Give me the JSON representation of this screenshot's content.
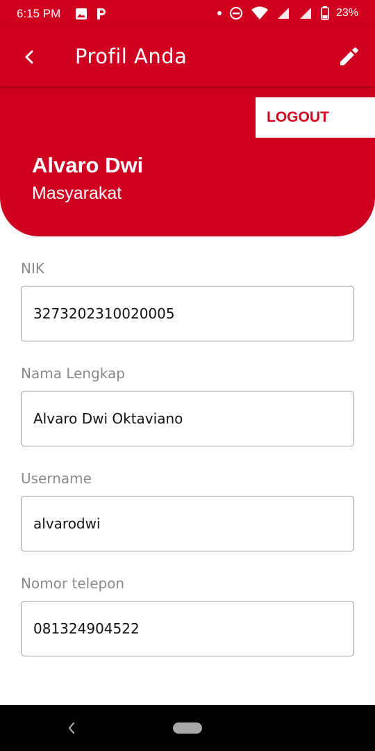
{
  "status_bar": {
    "time": "6:15 PM",
    "battery": "23%",
    "icons": [
      "image-icon",
      "p-app-icon",
      "dot-icon",
      "dnd-icon",
      "wifi-icon",
      "signal-icon",
      "signal-icon",
      "battery-icon"
    ]
  },
  "app_bar": {
    "title": "Profil Anda",
    "back_icon": "back-arrow-icon",
    "edit_icon": "pencil-icon"
  },
  "profile": {
    "logout_label": "LOGOUT",
    "name": "Alvaro Dwi",
    "role": "Masyarakat"
  },
  "form": {
    "nik_label": "NIK",
    "nik_value": "3273202310020005",
    "fullname_label": "Nama Lengkap",
    "fullname_value": "Alvaro Dwi Oktaviano",
    "username_label": "Username",
    "username_value": "alvarodwi",
    "phone_label": "Nomor telepon",
    "phone_value": "081324904522"
  },
  "colors": {
    "primary": "#cf0020",
    "label": "#8a8a8a",
    "border": "#9e9e9e"
  }
}
